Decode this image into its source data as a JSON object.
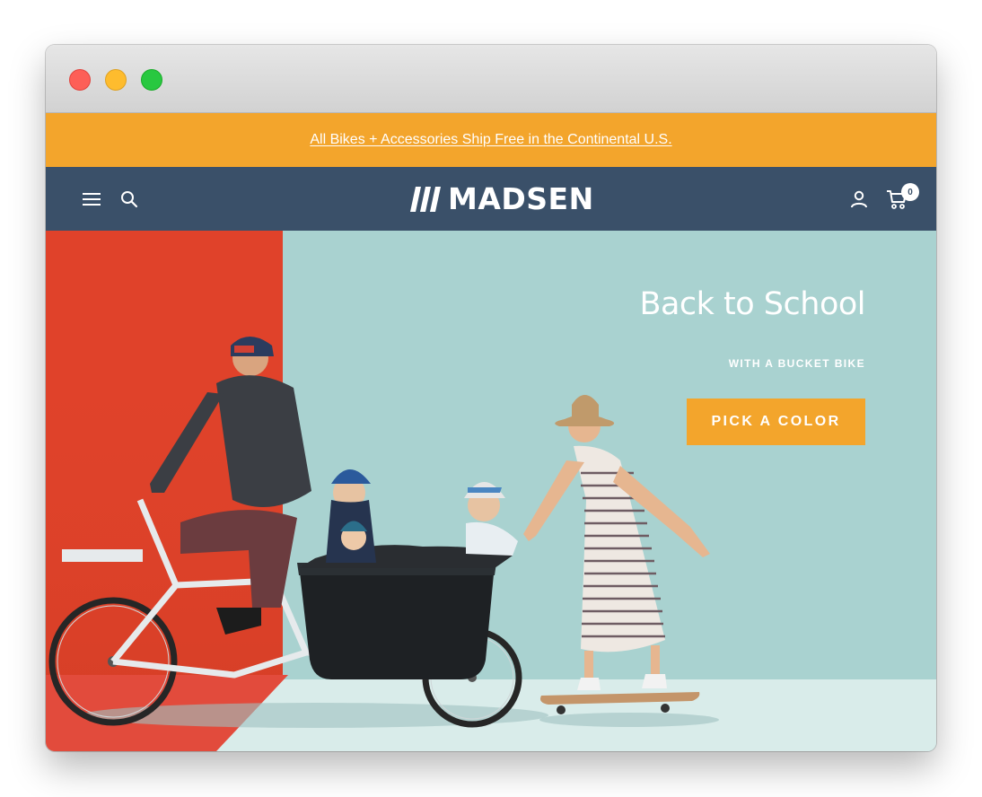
{
  "announcement": {
    "text": "All Bikes + Accessories Ship Free in the Continental U.S."
  },
  "header": {
    "logo_text": "MADSEN",
    "cart_count": "0",
    "icons": [
      "hamburger-menu-icon",
      "search-icon",
      "account-icon",
      "cart-icon"
    ]
  },
  "hero": {
    "title": "Back to School",
    "subtitle": "WITH A BUCKET BIKE",
    "cta_label": "PICK A COLOR"
  },
  "colors": {
    "announcement_bg": "#f3a52c",
    "nav_bg": "#3a5069",
    "cta_bg": "#f3a52c",
    "hero_wall_red": "#e0422a",
    "hero_wall_teal": "#a9d2d0"
  }
}
